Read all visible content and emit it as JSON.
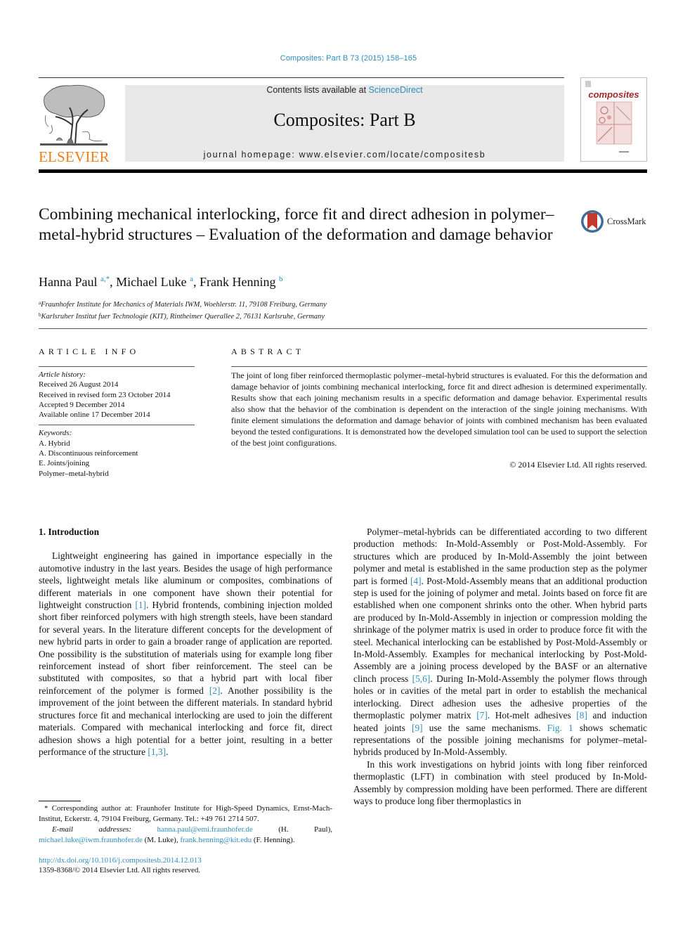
{
  "header": {
    "citation": "Composites: Part B 73 (2015) 158–165",
    "contents_prefix": "Contents lists available at ",
    "contents_link": "ScienceDirect",
    "journal_title": "Composites: Part B",
    "homepage": "journal homepage: www.elsevier.com/locate/compositesb",
    "publisher_logo_text": "ELSEVIER",
    "cover_title": "composites"
  },
  "article": {
    "title": "Combining mechanical interlocking, force fit and direct adhesion in polymer–metal-hybrid structures – Evaluation of the deformation and damage behavior",
    "crossmark_label": "CrossMark",
    "authors": [
      {
        "name": "Hanna Paul",
        "sup": "a,*"
      },
      {
        "name": "Michael Luke",
        "sup": "a"
      },
      {
        "name": "Frank Henning",
        "sup": "b"
      }
    ],
    "affiliations": [
      {
        "sup": "a",
        "text": "Fraunhofer Institute for Mechanics of Materials IWM, Woehlerstr. 11, 79108 Freiburg, Germany"
      },
      {
        "sup": "b",
        "text": "Karlsruher Institut fuer Technologie (KIT), Rintheimer Querallee 2, 76131 Karlsruhe, Germany"
      }
    ]
  },
  "article_info": {
    "heading": "ARTICLE INFO",
    "history_label": "Article history:",
    "history": [
      "Received 26 August 2014",
      "Received in revised form 23 October 2014",
      "Accepted 9 December 2014",
      "Available online 17 December 2014"
    ],
    "keywords_label": "Keywords:",
    "keywords": [
      "A. Hybrid",
      "A. Discontinuous reinforcement",
      "E. Joints/joining",
      "Polymer–metal-hybrid"
    ]
  },
  "abstract": {
    "heading": "ABSTRACT",
    "text": "The joint of long fiber reinforced thermoplastic polymer–metal-hybrid structures is evaluated. For this the deformation and damage behavior of joints combining mechanical interlocking, force fit and direct adhesion is determined experimentally. Results show that each joining mechanism results in a specific deformation and damage behavior. Experimental results also show that the behavior of the combination is dependent on the interaction of the single joining mechanisms. With finite element simulations the deformation and damage behavior of joints with combined mechanism has been evaluated beyond the tested configurations. It is demonstrated how the developed simulation tool can be used to support the selection of the best joint configurations.",
    "copyright": "© 2014 Elsevier Ltd. All rights reserved."
  },
  "body": {
    "section_title": "1. Introduction",
    "left_para": [
      {
        "t": "Lightweight engineering has gained in importance especially in the automotive industry in the last years. Besides the usage of high performance steels, lightweight metals like aluminum or compos­ites, combinations of different materials in one component have shown their potential for lightweight construction "
      },
      {
        "ref": "[1]"
      },
      {
        "t": ". Hybrid fron­tends, combining injection molded short fiber reinforced polymers with high strength steels, have been standard for several years. In the literature different concepts for the development of new hybrid parts in order to gain a broader range of application are reported. One possibility is the substitution of materials using for example long fiber reinforcement instead of short fiber reinforcement. The steel can be substituted with composites, so that a hybrid part with local fiber reinforcement of the polymer is formed "
      },
      {
        "ref": "[2]"
      },
      {
        "t": ". Another possibility is the improvement of the joint between the different materials. In standard hybrid structures force fit and mechanical interlocking are used to join the different materials. Compared with mechanical interlocking and force fit, direct adhesion shows a high potential for a better joint, resulting in a better performance of the structure "
      },
      {
        "ref": "[1,3]"
      },
      {
        "t": "."
      }
    ],
    "right_para1": [
      {
        "t": "Polymer–metal-hybrids can be differentiated according to two different production methods: In-Mold-Assembly or Post-Mold-Assembly. For structures which are produced by In-Mold-Assem­bly the joint between polymer and metal is established in the same production step as the polymer part is formed "
      },
      {
        "ref": "[4]"
      },
      {
        "t": ". Post-Mold-Assembly means that an additional production step is used for the joining of polymer and metal. Joints based on force fit are established when one component shrinks onto the other. When hybrid parts are produced by In-Mold-Assembly in injection or compression molding the shrinkage of the polymer matrix is used in order to produce force fit with the steel. Mechanical interlocking can be established by Post-Mold-Assembly or In-Mold-Assembly. Examples for mechanical interlocking by Post-Mold-Assembly are a joining process developed by the BASF or an alternative clinch process "
      },
      {
        "ref": "[5,6]"
      },
      {
        "t": ". During In-Mold-Assembly the polymer flows through holes or in cavities of the metal part in order to establish the mechanical interlocking. Direct adhesion uses the adhesive proper­ties of the thermoplastic polymer matrix "
      },
      {
        "ref": "[7]"
      },
      {
        "t": ". Hot-melt adhesives "
      },
      {
        "ref": "[8]"
      },
      {
        "t": " and induction heated joints "
      },
      {
        "ref": "[9]"
      },
      {
        "t": " use the same mechanisms. "
      },
      {
        "ref": "Fig. 1"
      },
      {
        "t": " shows schematic representations of the possible joining mechanisms for polymer–metal-hybrids produced by In-Mold-Assembly."
      }
    ],
    "right_para2": [
      {
        "t": "In this work investigations on hybrid joints with long fiber rein­forced thermoplastic (LFT) in combination with steel produced by In-Mold-Assembly by compression molding have been performed. There are different ways to produce long fiber thermoplastics in"
      }
    ]
  },
  "footnotes": {
    "corresponding": "* Corresponding author at: Fraunhofer Institute for High-Speed Dynamics, Ernst-Mach-Institut, Eckerstr. 4, 79104 Freiburg, Germany. Tel.: +49 761 2714 507.",
    "email_label": "E-mail addresses: ",
    "emails": [
      {
        "addr": "hanna.paul@emi.fraunhofer.de",
        "who": " (H. Paul), "
      },
      {
        "addr": "michael.luke@iwm.fraunhofer.de",
        "who": " (M. Luke), "
      },
      {
        "addr": "frank.henning@kit.edu",
        "who": " (F. Henning)."
      }
    ],
    "doi": "http://dx.doi.org/10.1016/j.compositesb.2014.12.013",
    "issn": "1359-8368/© 2014 Elsevier Ltd. All rights reserved."
  },
  "colors": {
    "link": "#2e8dbc",
    "elsevier_orange": "#f07d1a",
    "masthead_bg": "#e8e8e8",
    "cover_red": "#a3282b"
  }
}
